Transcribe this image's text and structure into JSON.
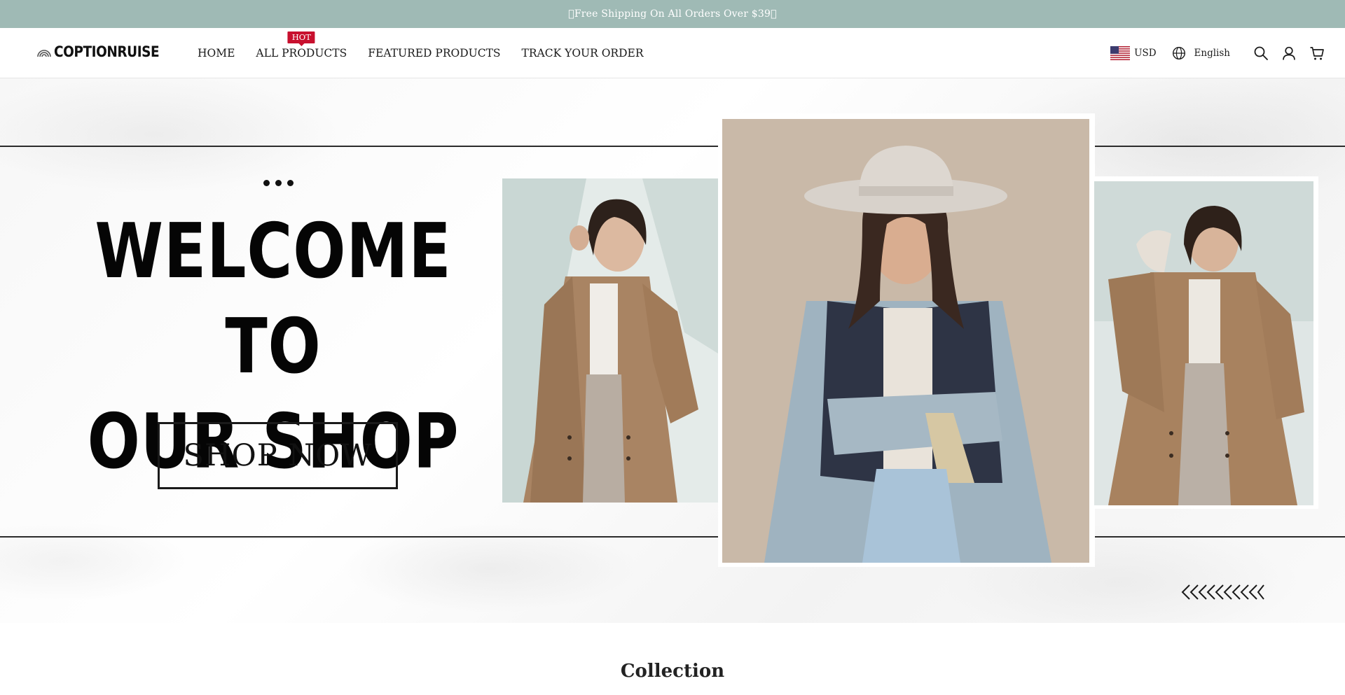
{
  "announcement": {
    "text": "Free Shipping On All Orders Over $39"
  },
  "brand": {
    "name": "COPTIONRUISE"
  },
  "nav": {
    "items": [
      {
        "label": "HOME"
      },
      {
        "label": "ALL PRODUCTS",
        "badge": "HOT"
      },
      {
        "label": "FEATURED PRODUCTS"
      },
      {
        "label": "TRACK YOUR ORDER"
      }
    ]
  },
  "tools": {
    "currency": "USD",
    "language": "English",
    "icons": [
      "us-flag-icon",
      "globe-icon",
      "search-icon",
      "user-icon",
      "cart-icon"
    ]
  },
  "hero": {
    "title_line1": "WELCOME TO",
    "title_line2": "OUR SHOP",
    "cta_label": "SHOP NOW"
  },
  "section": {
    "title": "Collection"
  },
  "colors": {
    "announcement_bg": "#9fbab5",
    "hot_badge": "#c8102e",
    "text": "#1a1a1a"
  }
}
